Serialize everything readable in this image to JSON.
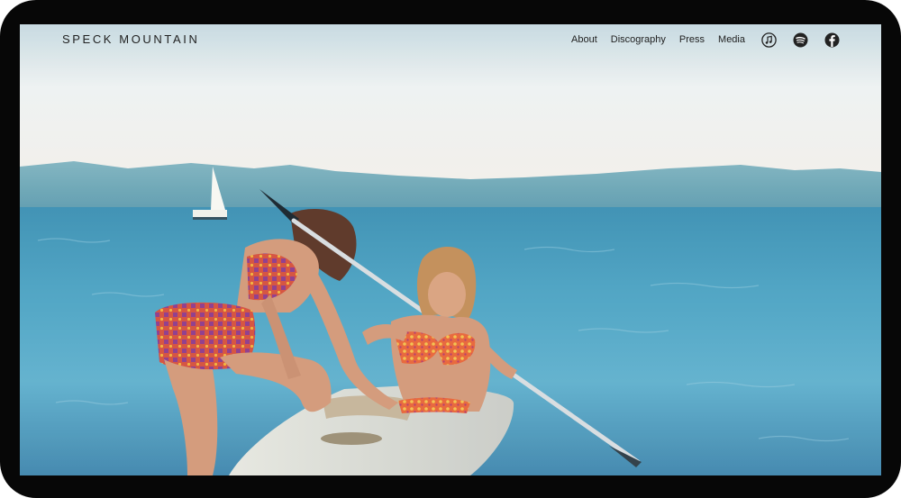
{
  "site": {
    "title": "SPECK MOUNTAIN"
  },
  "nav": {
    "items": [
      {
        "label": "About"
      },
      {
        "label": "Discography"
      },
      {
        "label": "Press"
      },
      {
        "label": "Media"
      }
    ],
    "icons": [
      "apple-music-icon",
      "spotify-icon",
      "facebook-icon"
    ]
  },
  "hero": {
    "description": "vintage photo of two women in bikinis with a small white boat on a lake, sailboat and mountains in background"
  },
  "colors": {
    "frame": "#070707",
    "text": "#222222",
    "water": "#3c8fb4",
    "sky": "#eef1f1"
  }
}
